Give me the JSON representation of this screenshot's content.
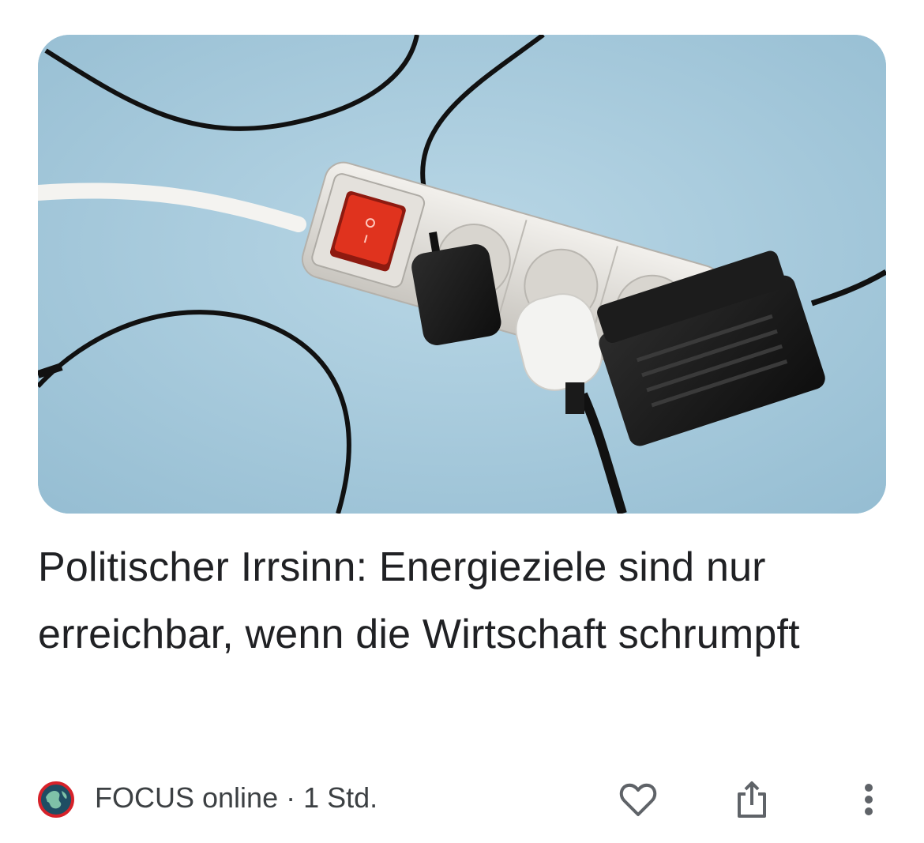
{
  "article": {
    "image_alt": "power-strip-photo",
    "headline": "Politischer Irrsinn: Energieziele sind nur erreichbar, wenn die Wirtschaft schrumpft",
    "source": "FOCUS online",
    "separator": "·",
    "age": "1 Std.",
    "source_line": "FOCUS online · 1 Std."
  },
  "actions": {
    "like_icon": "heart-outline-icon",
    "share_icon": "share-icon",
    "more_icon": "more-vert-icon"
  },
  "colors": {
    "text": "#202124",
    "meta_text": "#3c4043",
    "icon": "#5f6368",
    "photo_background": "#a9cbdc",
    "switch_red": "#e0331e"
  }
}
